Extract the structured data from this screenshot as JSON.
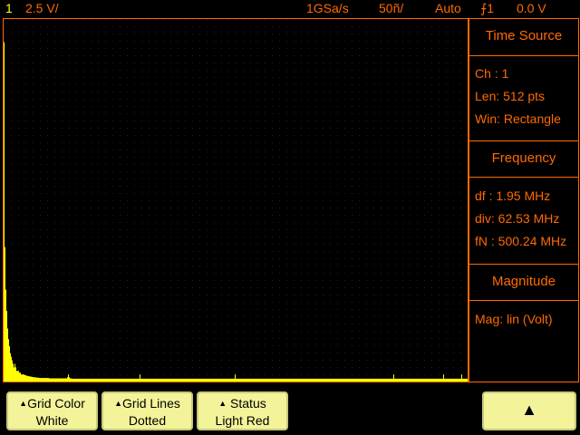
{
  "topbar": {
    "channel": "1",
    "volts_div": "2.5 V/",
    "sample_rate": "1GSa/s",
    "time_div": "50ñ/",
    "trigger_mode": "Auto",
    "trigger_source": "⨍1",
    "trigger_level": "0.0 V"
  },
  "panel": {
    "time_source": {
      "title": "Time Source",
      "ch": "Ch :  1",
      "len": "Len:  512  pts",
      "win": "Win: Rectangle"
    },
    "frequency": {
      "title": "Frequency",
      "df": "df :  1.95 MHz",
      "div": "div: 62.53 MHz",
      "fn": "fN : 500.24 MHz"
    },
    "magnitude": {
      "title": "Magnitude",
      "mag": "Mag: lin (Volt)"
    }
  },
  "softkeys": {
    "grid_color": {
      "label": "Grid Color",
      "value": "White"
    },
    "grid_lines": {
      "label": "Grid Lines",
      "value": "Dotted"
    },
    "status": {
      "label": "Status",
      "value": "Light Red"
    },
    "up_arrow": "▲"
  },
  "colors": {
    "trace": "#ffff00",
    "accent": "#ff6a00",
    "softkey_bg": "#f3f39a"
  },
  "spectrum": {
    "bins_shown": 512,
    "magnitudes": [
      0.96,
      0.38,
      0.26,
      0.2,
      0.15,
      0.12,
      0.1,
      0.08,
      0.07,
      0.06,
      0.05,
      0.04,
      0.05,
      0.04,
      0.03,
      0.03,
      0.03,
      0.025,
      0.025,
      0.02,
      0.02,
      0.02,
      0.02,
      0.018,
      0.018,
      0.016,
      0.016,
      0.015,
      0.015,
      0.014,
      0.014,
      0.013,
      0.013,
      0.012,
      0.012,
      0.012,
      0.011,
      0.011,
      0.011,
      0.01,
      0.01,
      0.01,
      0.01,
      0.01,
      0.01,
      0.01,
      0.01,
      0.01,
      0.01,
      0.01,
      0.009,
      0.009,
      0.009,
      0.009,
      0.009,
      0.009,
      0.009,
      0.009,
      0.009,
      0.009,
      0.009,
      0.009,
      0.009,
      0.009,
      0.009,
      0.009,
      0.009,
      0.009,
      0.009,
      0.009,
      0.012,
      0.02,
      0.012,
      0.009,
      0.009
    ]
  }
}
